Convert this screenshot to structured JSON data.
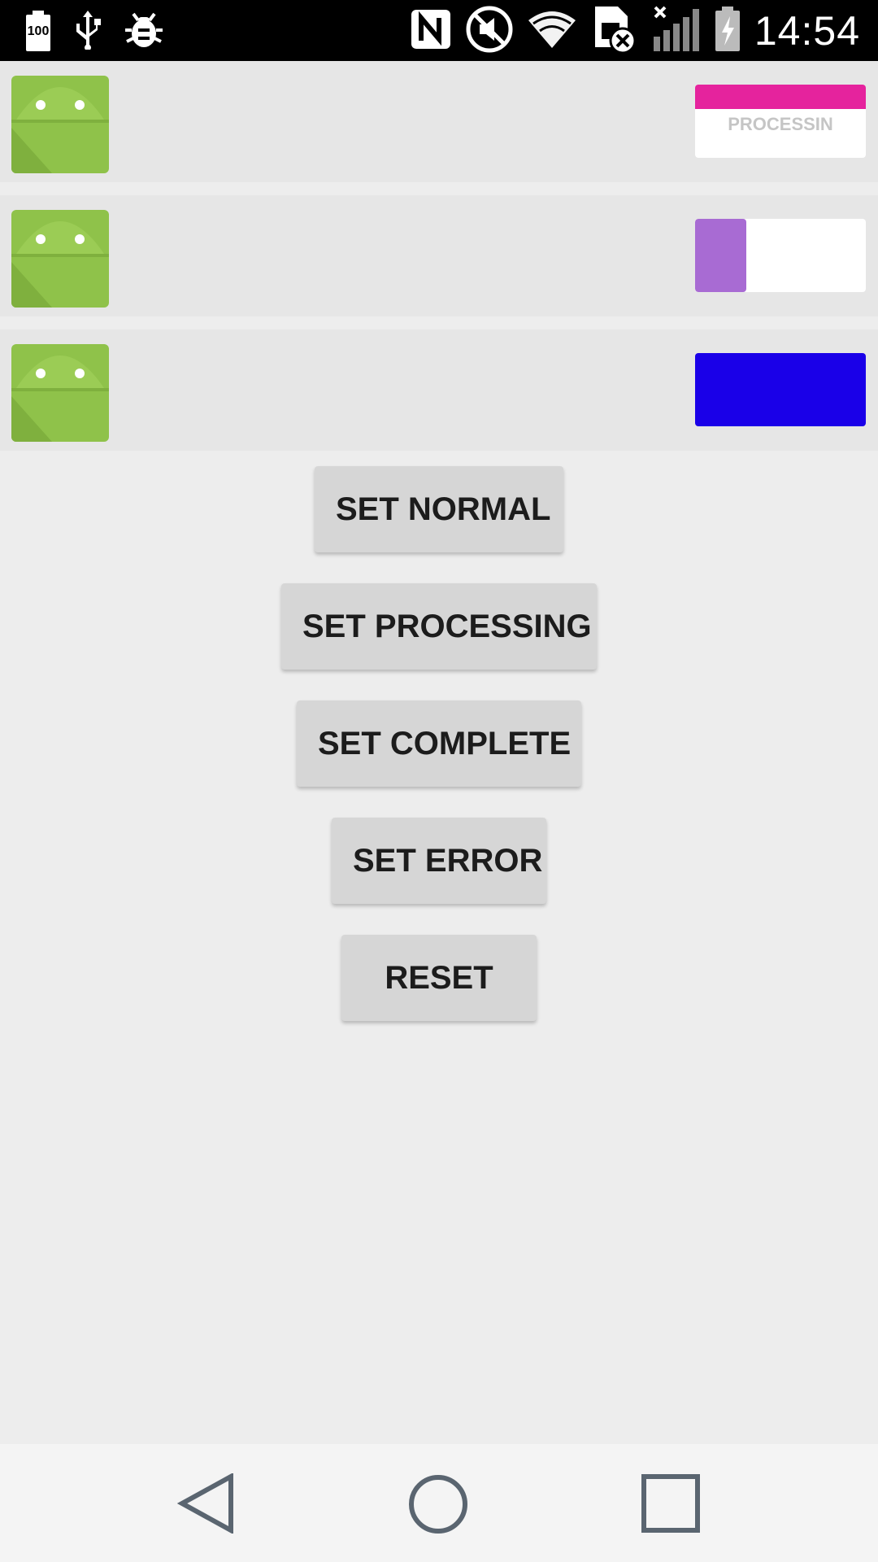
{
  "status_bar": {
    "battery_level_text": "100",
    "time": "14:54",
    "icons": [
      "battery-full-icon",
      "usb-icon",
      "debug-bug-icon",
      "nfc-icon",
      "mute-icon",
      "wifi-icon",
      "sim-error-icon",
      "signal-off-icon",
      "battery-charging-icon"
    ]
  },
  "rows": [
    {
      "state": "processing",
      "label": "PROCESSIN",
      "progress": 1.0,
      "bar_color": "#e5239d"
    },
    {
      "state": "progress",
      "progress": 0.3,
      "fill_color": "#a86bd3"
    },
    {
      "state": "complete",
      "color": "#1a00e8"
    }
  ],
  "buttons": {
    "set_normal": "SET NORMAL",
    "set_processing": "SET PROCESSING",
    "set_complete": "SET COMPLETE",
    "set_error": "SET ERROR",
    "reset": "RESET"
  },
  "nav_bar": {
    "icons": [
      "back-icon",
      "home-icon",
      "recents-icon"
    ]
  }
}
